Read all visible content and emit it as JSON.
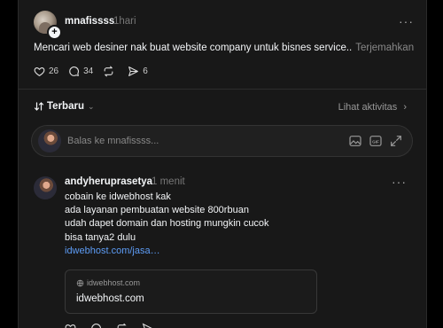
{
  "post": {
    "username": "mnafissss",
    "time": "1hari",
    "text": "Mencari web desiner nak buat website company untuk bisnes service..",
    "translate_label": "Terjemahkan",
    "likes": "26",
    "comments": "34",
    "shares": "6",
    "more": "···"
  },
  "replies_header": {
    "sort_label": "Terbaru",
    "activity_label": "Lihat aktivitas"
  },
  "reply_box": {
    "placeholder": "Balas ke mnafissss..."
  },
  "comment": {
    "username": "andyheruprasetya",
    "time": "1 menit",
    "more": "···",
    "lines": [
      "cobain ke idwebhost kak",
      "ada layanan pembuatan website 800rbuan",
      "udah dapet domain dan hosting mungkin cucok",
      "bisa tanya2 dulu"
    ],
    "link": "idwebhost.com/jasa…",
    "preview_host": "idwebhost.com",
    "preview_title": "idwebhost.com"
  }
}
